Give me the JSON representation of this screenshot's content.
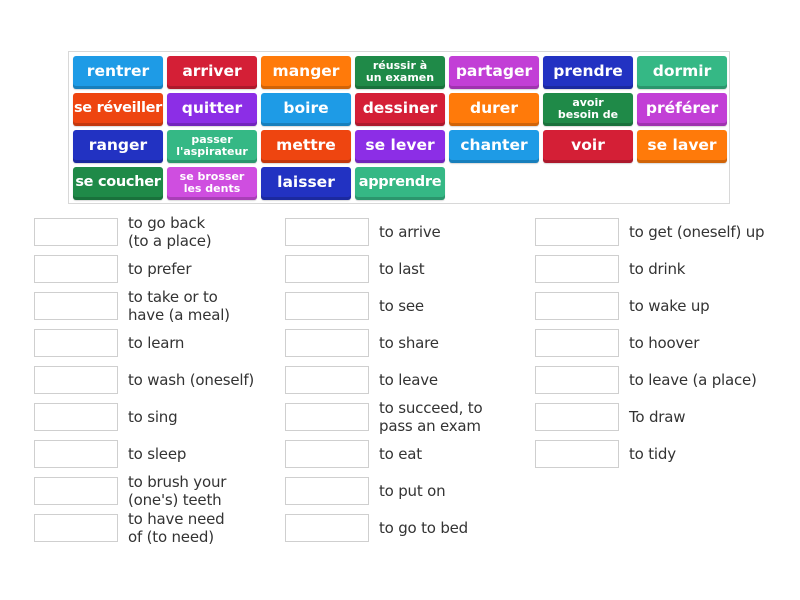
{
  "word_bank": {
    "tiles": [
      {
        "text": "rentrer",
        "color": "#1e9be6"
      },
      {
        "text": "arriver",
        "color": "#d41f36"
      },
      {
        "text": "manger",
        "color": "#ff7a0a"
      },
      {
        "text": "réussir à\nun examen",
        "color": "#1f8a48"
      },
      {
        "text": "partager",
        "color": "#c23fd6"
      },
      {
        "text": "prendre",
        "color": "#2232c2"
      },
      {
        "text": "dormir",
        "color": "#35b885"
      },
      {
        "text": "se réveiller",
        "color": "#ee4510"
      },
      {
        "text": "quitter",
        "color": "#8c2ee6"
      },
      {
        "text": "boire",
        "color": "#1e9be6"
      },
      {
        "text": "dessiner",
        "color": "#d41f36"
      },
      {
        "text": "durer",
        "color": "#ff7a0a"
      },
      {
        "text": "avoir\nbesoin de",
        "color": "#1f8a48"
      },
      {
        "text": "préférer",
        "color": "#c23fd6"
      },
      {
        "text": "ranger",
        "color": "#2232c2"
      },
      {
        "text": "passer\nl'aspirateur",
        "color": "#35b885"
      },
      {
        "text": "mettre",
        "color": "#ee4510"
      },
      {
        "text": "se lever",
        "color": "#8c2ee6"
      },
      {
        "text": "chanter",
        "color": "#1e9be6"
      },
      {
        "text": "voir",
        "color": "#d41f36"
      },
      {
        "text": "se laver",
        "color": "#ff7a0a"
      },
      {
        "text": "se coucher",
        "color": "#1f8a48"
      },
      {
        "text": "se brosser\nles dents",
        "color": "#cf4ee0"
      },
      {
        "text": "laisser",
        "color": "#2232c2"
      },
      {
        "text": "apprendre",
        "color": "#35b885"
      }
    ]
  },
  "definitions": {
    "column1": [
      "to go back\n(to a place)",
      "to prefer",
      "to take or to\nhave (a meal)",
      "to learn",
      "to wash (oneself)",
      "to sing",
      "to sleep",
      "to brush your\n(one's) teeth",
      "to have need\nof (to need)"
    ],
    "column2": [
      "to arrive",
      "to last",
      "to see",
      "to share",
      "to leave",
      "to succeed, to\npass an exam",
      "to eat",
      "to put on",
      "to go to bed"
    ],
    "column3": [
      "to get (oneself) up",
      "to drink",
      "to wake up",
      "to hoover",
      "to leave (a place)",
      "To draw",
      "to tidy"
    ]
  }
}
